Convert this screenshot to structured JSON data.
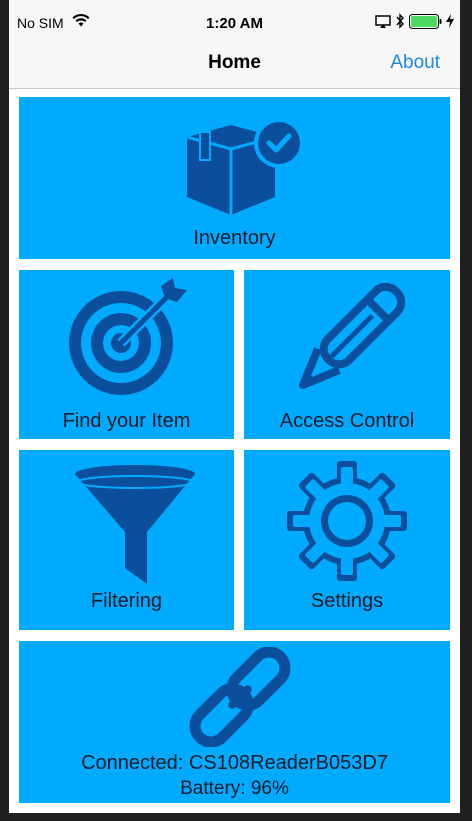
{
  "status_bar": {
    "carrier": "No SIM",
    "time": "1:20 AM",
    "icons": [
      "wifi-icon",
      "airplay-icon",
      "bluetooth-icon",
      "battery-icon",
      "charging-icon"
    ]
  },
  "nav": {
    "title": "Home",
    "about_label": "About"
  },
  "tiles": {
    "inventory": {
      "label": "Inventory",
      "icon": "box-check-icon"
    },
    "find_item": {
      "label": "Find your Item",
      "icon": "target-icon"
    },
    "access_control": {
      "label": "Access Control",
      "icon": "pencil-icon"
    },
    "filtering": {
      "label": "Filtering",
      "icon": "funnel-icon"
    },
    "settings": {
      "label": "Settings",
      "icon": "gear-icon"
    },
    "connection": {
      "icon": "link-icon",
      "connected": "Connected: CS108ReaderB053D7",
      "battery": "Battery: 96%"
    }
  },
  "colors": {
    "tile_bg": "#00aaff",
    "icon": "#0b4f9c",
    "accent": "#1e88e5",
    "battery_fill": "#4cd964"
  }
}
